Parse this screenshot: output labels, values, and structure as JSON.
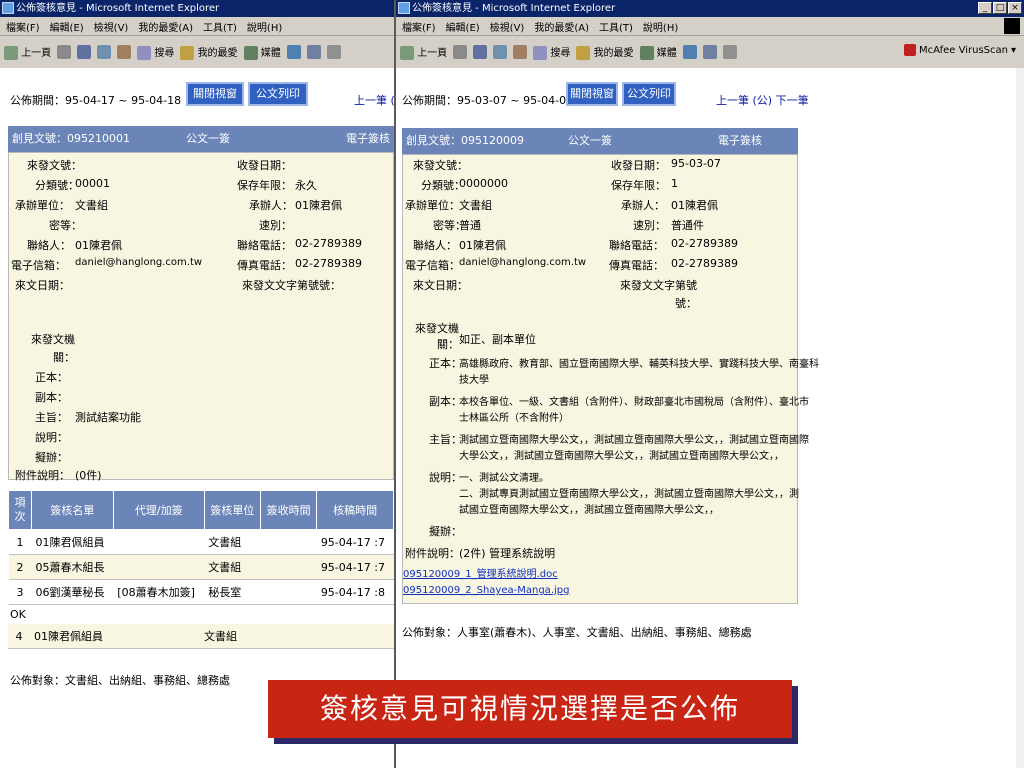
{
  "left": {
    "window_title": "公佈簽核意見 - Microsoft Internet Explorer",
    "menu": [
      "檔案(F)",
      "編輯(E)",
      "檢視(V)",
      "我的最愛(A)",
      "工具(T)",
      "說明(H)"
    ],
    "toolbar": {
      "back": "上一頁",
      "search": "搜尋",
      "favorites": "我的最愛",
      "media": "媒體"
    },
    "period": "公佈期間：95-04-17 ~ 95-04-18",
    "close_label": "關閉視窗",
    "print_label": "公文列印",
    "nav_prev": "上一筆 (",
    "header": {
      "number": "創見文號：095210001",
      "class": "公文一簽",
      "type": "電子簽核"
    },
    "fields": {
      "l1": "來發文號：",
      "r1": "收發日期：",
      "l2": "分類號：",
      "v2": "00001",
      "r2": "保存年限：",
      "rv2": "永久",
      "l3": "承辦單位：",
      "v3": "文書組",
      "r3": "承辦人：",
      "rv3": "01陳君佩",
      "l4": "密等：",
      "r4": "速別：",
      "l5": "聯絡人：",
      "v5": "01陳君佩",
      "r5": "聯絡電話：",
      "rv5": "02-2789389",
      "l6": "電子信箱：",
      "v6": "daniel@hanglong.com.tw",
      "r6": "傳真電話：",
      "rv6": "02-2789389",
      "l7": "來文日期：",
      "r7": "來發文文字第號號：",
      "l8": "來發文機關：",
      "l9": "正本：",
      "l10": "副本：",
      "l11": "主旨：",
      "v11": "測試結案功能",
      "l12": "說明：",
      "l13": "擬辦：",
      "l14": "附件說明：",
      "v14": "(0件)"
    },
    "table": {
      "headers": [
        "項次",
        "簽核名單",
        "代理/加簽",
        "簽核單位",
        "簽收時間",
        "核稿時間"
      ],
      "rows": [
        {
          "no": "1",
          "name": "01陳君佩組員",
          "proxy": "",
          "unit": "文書組",
          "time": "95-04-17 :7"
        },
        {
          "no": "2",
          "name": "05蕭春木組長",
          "proxy": "",
          "unit": "文書組",
          "time": "95-04-17 :7"
        },
        {
          "no": "3",
          "name": "06劉漢華秘長",
          "proxy": "[08蕭春木加簽]",
          "unit": "秘長室",
          "time": "95-04-17 :8"
        },
        {
          "no": "4",
          "name": "01陳君佩組員",
          "proxy": "",
          "unit": "文書組",
          "time": ""
        }
      ],
      "ok_label": "OK"
    },
    "audience": "公佈對象：文書組、出納組、事務組、總務處"
  },
  "right": {
    "window_title": "公佈簽核意見 - Microsoft Internet Explorer",
    "menu": [
      "檔案(F)",
      "編輯(E)",
      "檢視(V)",
      "我的最愛(A)",
      "工具(T)",
      "說明(H)"
    ],
    "toolbar": {
      "back": "上一頁",
      "search": "搜尋",
      "favorites": "我的最愛",
      "media": "媒體",
      "address": "McAfee VirusScan"
    },
    "period": "公佈期間：95-03-07 ~ 95-04-07",
    "close_label": "關閉視窗",
    "print_label": "公文列印",
    "nav": "上一筆 (公) 下一筆",
    "header": {
      "number": "創見文號：095120009",
      "class": "公文一簽",
      "type": "電子簽核"
    },
    "fields": {
      "l1": "來發文號：",
      "r1": "收發日期：",
      "rv1": "95-03-07",
      "l2": "分類號：",
      "v2": "0000000",
      "r2": "保存年限：",
      "rv2": "1",
      "l3": "承辦單位：",
      "v3": "文書組",
      "r3": "承辦人：",
      "rv3": "01陳君佩",
      "l4": "密等：",
      "v4": "普通",
      "r4": "速別：",
      "rv4": "普通件",
      "l5": "聯絡人：",
      "v5": "01陳君佩",
      "r5": "聯絡電話：",
      "rv5": "02-2789389",
      "l6": "電子信箱：",
      "v6": "daniel@hanglong.com.tw",
      "r6": "傳真電話：",
      "rv6": "02-2789389",
      "l7": "來文日期：",
      "r7": "來發文文字第號號：",
      "l8": "來發文機關：",
      "v8": "如正、副本單位",
      "l9": "正本：",
      "v9a": "高雄縣政府、教育部、國立暨南國際大學、輔英科技大學、實踐科技大學、南臺科",
      "v9b": "技大學",
      "l10": "副本：",
      "v10a": "本校各單位、一級、文書組（含附件）、財政部臺北市國稅局（含附件）、臺北市",
      "v10b": "士林區公所（不含附件）",
      "l11": "主旨：",
      "v11a": "測試國立暨南國際大學公文，，測試國立暨南國際大學公文，，測試國立暨南國際",
      "v11b": "大學公文，，測試國立暨南國際大學公文，，測試國立暨南國際大學公文，，",
      "l12": "說明：",
      "v12a": "一、測試公文清理。",
      "v12b": "二、測試專頁測試國立暨南國際大學公文，，測試國立暨南國際大學公文，，測",
      "v12c": "試國立暨南國際大學公文，，測試國立暨南國際大學公文，，",
      "l13": "擬辦：",
      "l14": "附件說明：",
      "v14": "(2件) 管理系統說明",
      "file1": "095120009_1_管理系統說明.doc",
      "file2": "095120009_2_Shayea-Manga.jpg"
    },
    "audience": "公佈對象：人事室(蕭春木)、人事室、文書組、出納組、事務組、總務處"
  },
  "caption": "簽核意見可視情況選擇是否公佈",
  "colors": {
    "header_blue": "#6b85b8",
    "button_blue": "#3060c0",
    "form_bg": "#f8f5e1",
    "caption_red": "#c82514"
  }
}
